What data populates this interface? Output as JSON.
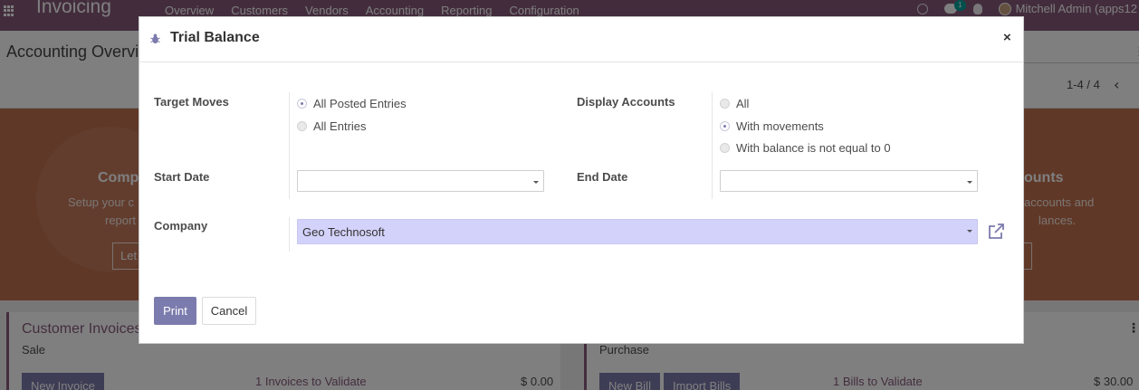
{
  "app": {
    "brand": "Invoicing",
    "menu": [
      "Overview",
      "Customers",
      "Vendors",
      "Accounting",
      "Reporting",
      "Configuration"
    ],
    "chat_badge": "1",
    "user": "Mitchell Admin (apps12"
  },
  "control_panel": {
    "title": "Accounting Overvi",
    "pager": "1-4 / 4"
  },
  "banner": {
    "left_title": "Comp",
    "left_text_line1": "Setup your c",
    "left_text_line2": "report",
    "left_button": "Let",
    "right_title": "ounts",
    "right_text_line1": "accounts and",
    "right_text_line2": "lances."
  },
  "cards": {
    "left": {
      "title": "Customer Invoices",
      "type": "Sale",
      "button": "New Invoice",
      "stat": "1 Invoices to Validate",
      "amount": "$ 0.00"
    },
    "right": {
      "type": "Purchase",
      "button1": "New Bill",
      "button2": "Import Bills",
      "stat": "1 Bills to Validate",
      "amount": "$ 30.00"
    }
  },
  "dialog": {
    "title": "Trial Balance",
    "close_glyph": "×",
    "target_moves": {
      "label": "Target Moves",
      "options": [
        "All Posted Entries",
        "All Entries"
      ],
      "selected": "All Posted Entries"
    },
    "display_accounts": {
      "label": "Display Accounts",
      "options": [
        "All",
        "With movements",
        "With balance is not equal to 0"
      ],
      "selected": "With movements"
    },
    "start_date": {
      "label": "Start Date",
      "value": ""
    },
    "end_date": {
      "label": "End Date",
      "value": ""
    },
    "company": {
      "label": "Company",
      "value": "Geo Technosoft"
    },
    "print_label": "Print",
    "cancel_label": "Cancel"
  },
  "colors": {
    "brand": "#875a7b",
    "primary_button": "#7c7bad",
    "company_field_bg": "#d3d2fa",
    "banner_bg": "#c1704f"
  },
  "icons": {
    "dialog": "bug-icon",
    "close": "close-icon",
    "external": "external-link-icon"
  }
}
